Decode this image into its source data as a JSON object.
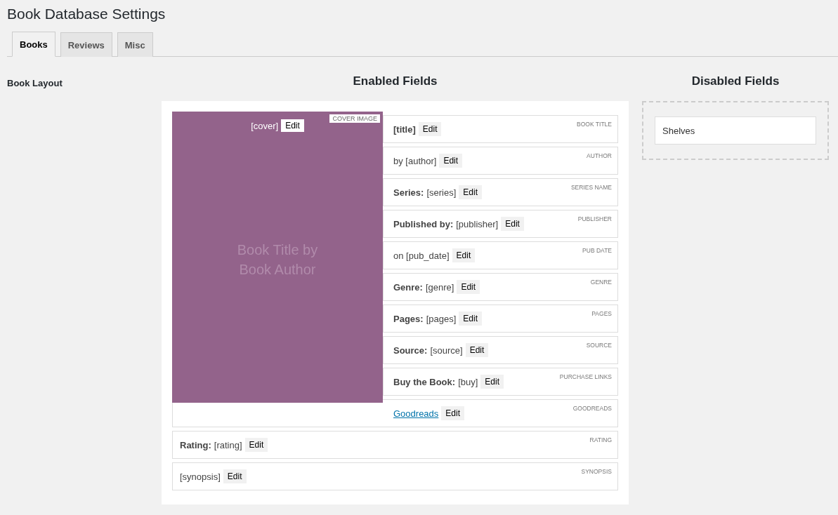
{
  "page_title": "Book Database Settings",
  "tabs": [
    {
      "label": "Books",
      "selected": true
    },
    {
      "label": "Reviews",
      "selected": false
    },
    {
      "label": "Misc",
      "selected": false
    }
  ],
  "section_label": "Book Layout",
  "enabled": {
    "heading": "Enabled Fields",
    "cover": {
      "value": "[cover]",
      "edit": "Edit",
      "tag": "COVER IMAGE",
      "placeholder": "Book Title by Book Author"
    },
    "fields_beside_cover": [
      {
        "label": "[title]",
        "edit": "Edit",
        "tag": "BOOK TITLE"
      },
      {
        "kind": "text",
        "value": "by [author]",
        "edit": "Edit",
        "tag": "AUTHOR"
      },
      {
        "kind": "text",
        "label": "Series:",
        "value": "[series]",
        "edit": "Edit",
        "tag": "SERIES NAME"
      },
      {
        "kind": "text",
        "label": "Published by:",
        "value": "[publisher]",
        "edit": "Edit",
        "tag": "PUBLISHER"
      },
      {
        "kind": "text",
        "value": "on [pub_date]",
        "edit": "Edit",
        "tag": "PUB DATE"
      },
      {
        "kind": "text",
        "label": "Genre:",
        "value": "[genre]",
        "edit": "Edit",
        "tag": "GENRE"
      },
      {
        "kind": "text",
        "label": "Pages:",
        "value": "[pages]",
        "edit": "Edit",
        "tag": "PAGES"
      },
      {
        "kind": "text",
        "label": "Source:",
        "value": "[source]",
        "edit": "Edit",
        "tag": "SOURCE"
      },
      {
        "kind": "text",
        "label": "Buy the Book:",
        "value": "[buy]",
        "edit": "Edit",
        "tag": "PURCHASE LINKS"
      },
      {
        "kind": "link",
        "value": "Goodreads",
        "edit": "Edit",
        "tag": "GOODREADS"
      }
    ],
    "fields_below": [
      {
        "kind": "text",
        "label": "Rating:",
        "value": "[rating]",
        "edit": "Edit",
        "tag": "RATING"
      },
      {
        "kind": "text",
        "value": "[synopsis]",
        "edit": "Edit",
        "tag": "SYNOPSIS"
      }
    ]
  },
  "disabled": {
    "heading": "Disabled Fields",
    "fields": [
      {
        "label": "Shelves"
      }
    ]
  }
}
